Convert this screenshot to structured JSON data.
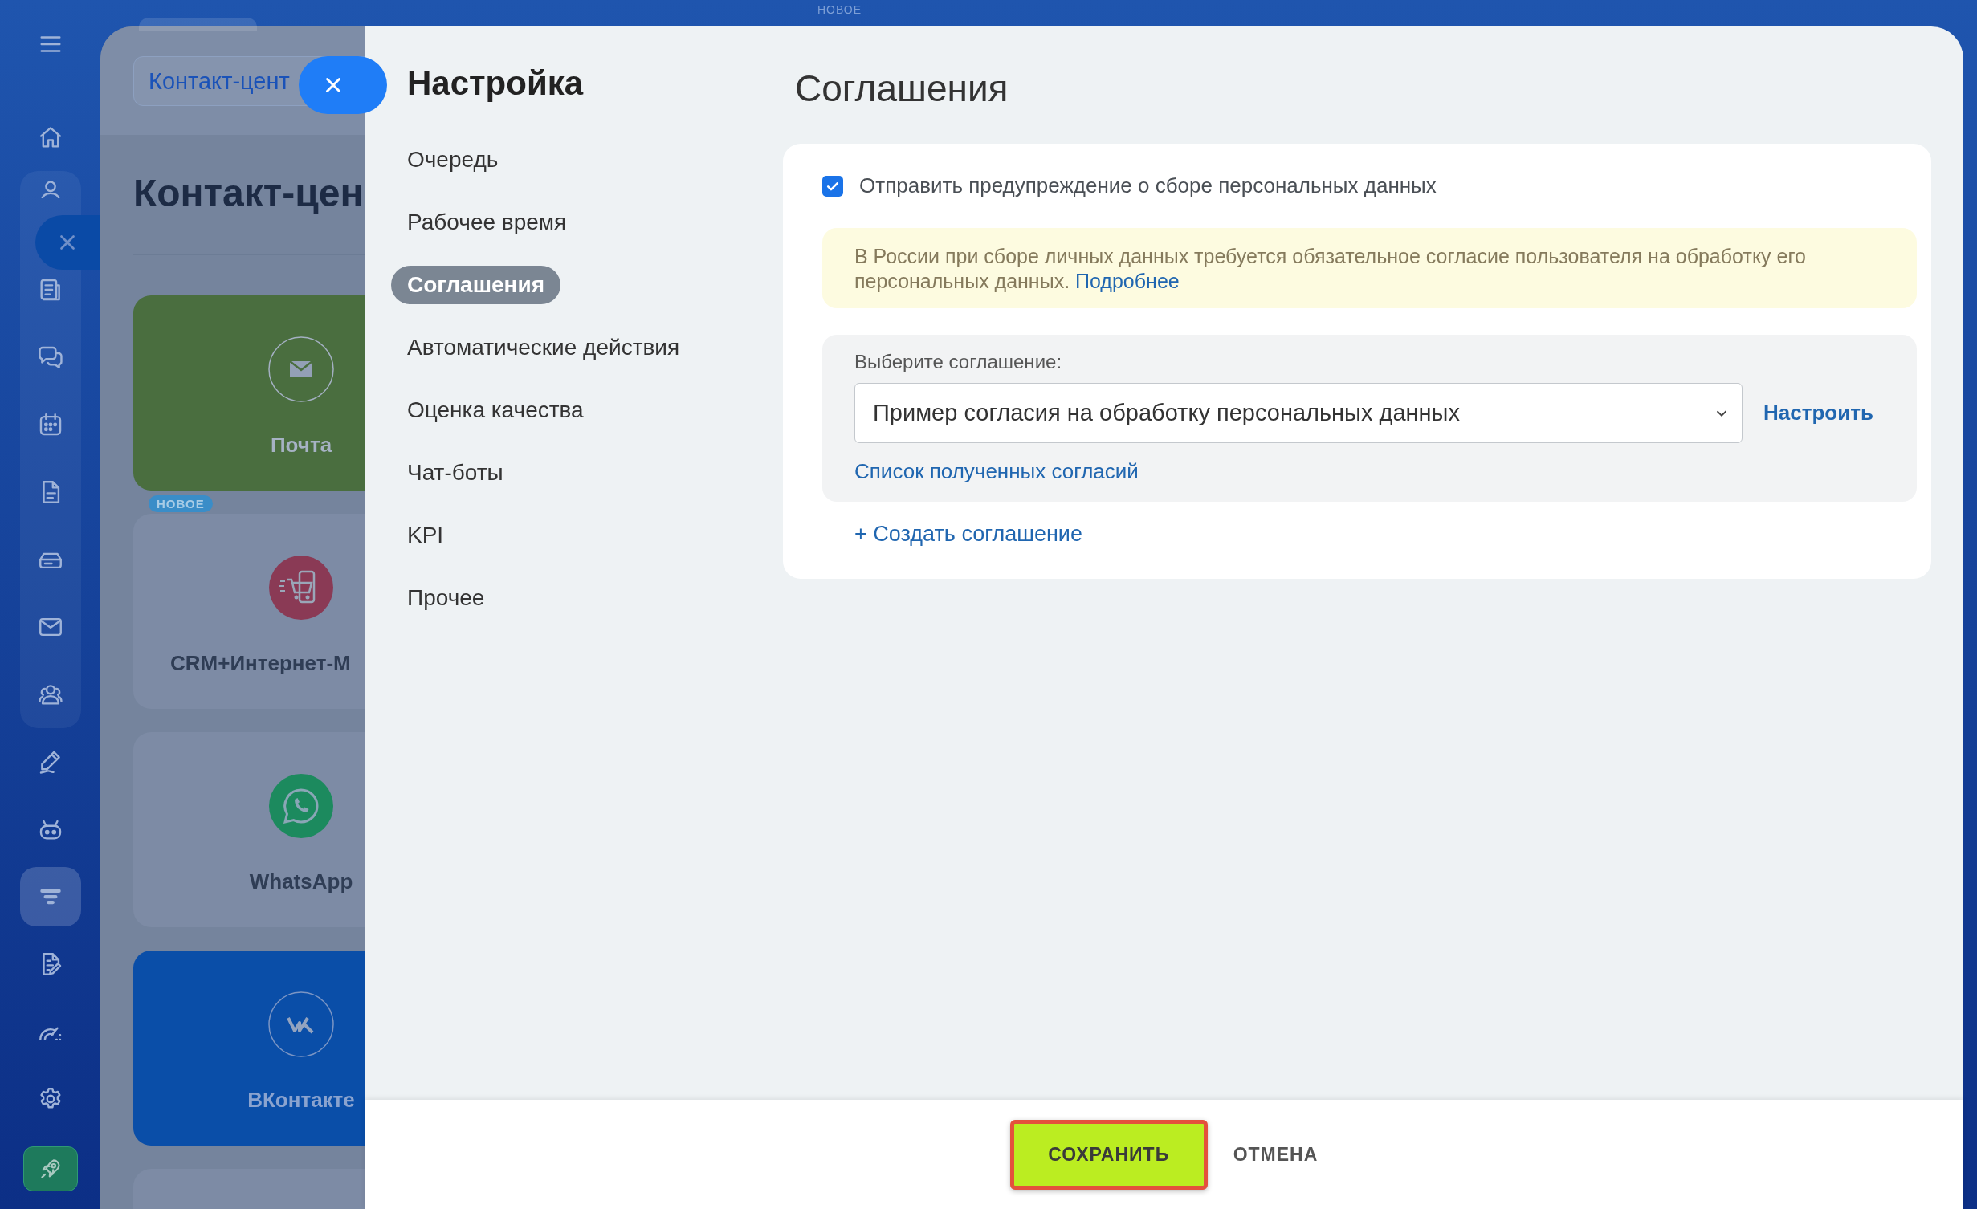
{
  "top_badge": "НОВОЕ",
  "sidebar": {
    "top_items": [
      {
        "kind": "home",
        "selected": false
      }
    ],
    "group_items": [
      {
        "kind": "person",
        "selected": false
      },
      {
        "kind": "feed",
        "selected": false
      },
      {
        "kind": "chat",
        "selected": false
      },
      {
        "kind": "calendar",
        "selected": false
      },
      {
        "kind": "document",
        "selected": false
      },
      {
        "kind": "drive",
        "selected": false
      },
      {
        "kind": "mail",
        "selected": false
      },
      {
        "kind": "contacts",
        "selected": false
      }
    ],
    "bottom_items": [
      {
        "kind": "sign",
        "selected": false
      },
      {
        "kind": "robot",
        "selected": false
      },
      {
        "kind": "funnel",
        "selected": true
      },
      {
        "kind": "doc_edit",
        "selected": false
      },
      {
        "kind": "analytics",
        "selected": false
      },
      {
        "kind": "settings",
        "selected": false
      }
    ]
  },
  "background": {
    "breadcrumb": "Контакт-цент",
    "title": "Контакт-цен",
    "cards": [
      {
        "kind": "mail",
        "label": "Почта",
        "color": "#4a6e3f"
      },
      {
        "kind": "shop",
        "label": "CRM+Интернет-М",
        "badge": "НОВОЕ",
        "color": "#7d8ba5"
      },
      {
        "kind": "whatsapp",
        "label": "WhatsApp",
        "color": "#7d8ba5"
      },
      {
        "kind": "vk",
        "label": "ВКонтакте",
        "color": "#0a4ea8"
      },
      {
        "kind": "blank",
        "color": "#7d8ba5"
      }
    ]
  },
  "settings": {
    "title": "Настройка",
    "menu": [
      {
        "label": "Очередь",
        "selected": false
      },
      {
        "label": "Рабочее время",
        "selected": false
      },
      {
        "label": "Соглашения",
        "selected": true
      },
      {
        "label": "Автоматические действия",
        "selected": false
      },
      {
        "label": "Оценка качества",
        "selected": false
      },
      {
        "label": "Чат-боты",
        "selected": false
      },
      {
        "label": "KPI",
        "selected": false
      },
      {
        "label": "Прочее",
        "selected": false
      }
    ]
  },
  "content": {
    "heading": "Соглашения",
    "send_warning": {
      "label": "Отправить предупреждение о сборе персональных данных",
      "checked": true
    },
    "notice": {
      "text": "В России при сборе личных данных требуется обязательное согласие пользователя на обработку его персональных данных.",
      "link": "Подробнее"
    },
    "agreement": {
      "label": "Выберите соглашение:",
      "value": "Пример согласия на обработку персональных данных",
      "configure": "Настроить",
      "list_link": "Список полученных согласий"
    },
    "create_link": "+ Создать соглашение"
  },
  "footer": {
    "buttons": [
      {
        "kind": "primary",
        "label": "СОХРАНИТЬ",
        "highlighted": true
      },
      {
        "kind": "link",
        "label": "ОТМЕНА",
        "highlighted": false
      }
    ]
  }
}
